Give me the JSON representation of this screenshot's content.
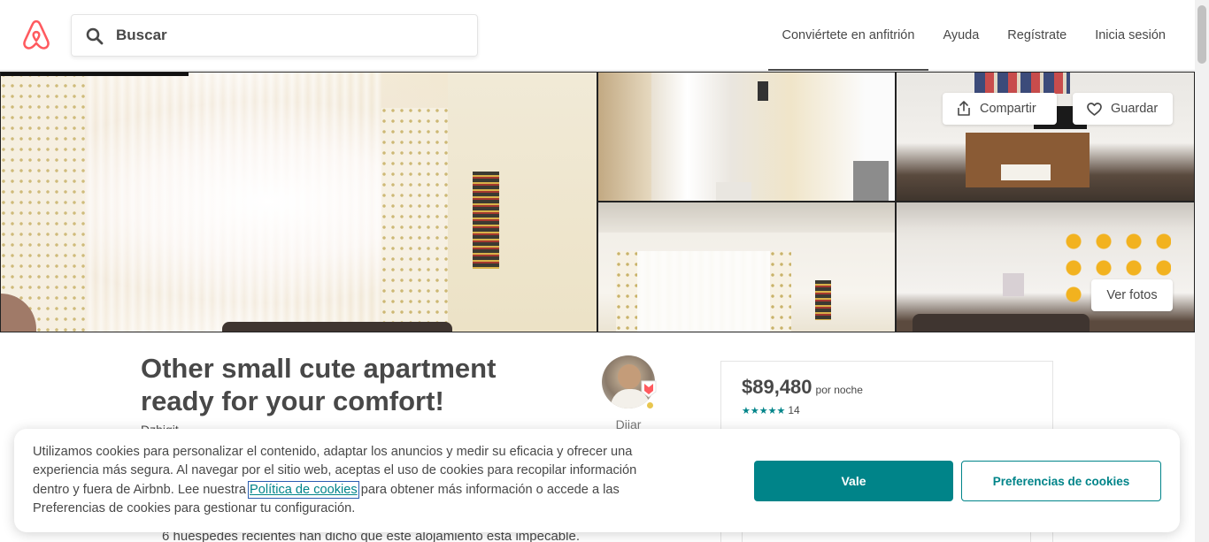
{
  "header": {
    "search_placeholder": "Buscar",
    "nav": [
      {
        "label": "Conviértete en anfitrión"
      },
      {
        "label": "Ayuda"
      },
      {
        "label": "Regístrate"
      },
      {
        "label": "Inicia sesión"
      }
    ]
  },
  "gallery": {
    "share_label": "Compartir",
    "save_label": "Guardar",
    "view_photos_label": "Ver fotos"
  },
  "listing": {
    "title": "Other small cute apartment ready for your comfort!",
    "location": "Dzhigit...",
    "host_name": "Dijar",
    "cleanliness_text": "6 huéspedes recientes han dicho que este alojamiento está impecable."
  },
  "booking": {
    "price": "$89,480",
    "per_night": "por noche",
    "stars": "★★★★★",
    "review_count": "14",
    "rating_fraction": 1.0
  },
  "cookie_banner": {
    "text_before": "Utilizamos cookies para personalizar el contenido, adaptar los anuncios y medir su eficacia y ofrecer una experiencia más segura. Al navegar por el sitio web, aceptas el uso de cookies para recopilar información dentro y fuera de Airbnb. Lee nuestra ",
    "link_text": "Política de cookies",
    "text_after": " para obtener más información o accede a las Preferencias de cookies para gestionar tu configuración.",
    "accept_label": "Vale",
    "prefs_label": "Preferencias de cookies"
  },
  "colors": {
    "brand": "#FF5A5F",
    "accent": "#008489",
    "text": "#484848"
  },
  "icons": [
    "airbnb-logo-icon",
    "search-icon",
    "share-icon",
    "heart-icon",
    "superhost-badge-icon"
  ]
}
